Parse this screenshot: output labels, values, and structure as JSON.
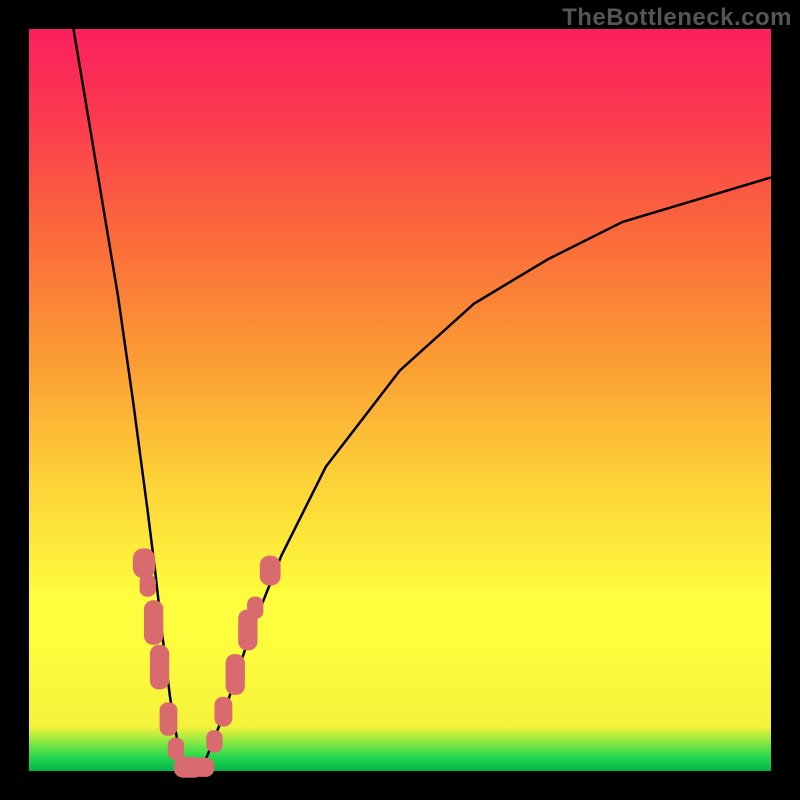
{
  "watermark": "TheBottleneck.com",
  "colors": {
    "page_bg": "#000000",
    "gradient_top": "#fb1f5e",
    "gradient_mid": "#fefe3e",
    "gradient_bottom": "#00b64a",
    "curve": "#000000",
    "marker": "#d96b6e"
  },
  "chart_data": {
    "type": "line",
    "title": "",
    "xlabel": "",
    "ylabel": "",
    "xlim": [
      0,
      100
    ],
    "ylim": [
      0,
      100
    ],
    "grid": false,
    "legend": false,
    "series": [
      {
        "name": "bottleneck-curve",
        "x": [
          6,
          8,
          10,
          12,
          14,
          16,
          17,
          18,
          19,
          20,
          21,
          22,
          23,
          24,
          26,
          28,
          30,
          34,
          40,
          50,
          60,
          70,
          80,
          90,
          100
        ],
        "y": [
          100,
          88,
          76,
          64,
          50,
          35,
          27,
          18,
          10,
          4,
          0,
          0,
          0,
          2,
          7,
          13,
          19,
          29,
          41,
          54,
          63,
          69,
          74,
          77,
          80
        ]
      }
    ],
    "markers": [
      {
        "x": 15.5,
        "y": 28,
        "shape": "rounded-rect",
        "w": 3.0,
        "h": 4.0
      },
      {
        "x": 16.0,
        "y": 25,
        "shape": "rounded-rect",
        "w": 2.2,
        "h": 3.0
      },
      {
        "x": 16.8,
        "y": 20,
        "shape": "rounded-rect",
        "w": 2.6,
        "h": 6.0
      },
      {
        "x": 17.6,
        "y": 14,
        "shape": "rounded-rect",
        "w": 2.6,
        "h": 6.0
      },
      {
        "x": 18.8,
        "y": 7,
        "shape": "rounded-rect",
        "w": 2.4,
        "h": 4.5
      },
      {
        "x": 19.8,
        "y": 3,
        "shape": "rounded-rect",
        "w": 2.2,
        "h": 3.0
      },
      {
        "x": 21.5,
        "y": 0.5,
        "shape": "rounded-rect",
        "w": 4.0,
        "h": 2.8
      },
      {
        "x": 23.5,
        "y": 0.5,
        "shape": "rounded-rect",
        "w": 3.0,
        "h": 2.6
      },
      {
        "x": 25.0,
        "y": 4,
        "shape": "rounded-rect",
        "w": 2.2,
        "h": 3.0
      },
      {
        "x": 26.2,
        "y": 8,
        "shape": "rounded-rect",
        "w": 2.4,
        "h": 4.0
      },
      {
        "x": 27.8,
        "y": 13,
        "shape": "rounded-rect",
        "w": 2.6,
        "h": 5.5
      },
      {
        "x": 29.5,
        "y": 19,
        "shape": "rounded-rect",
        "w": 2.6,
        "h": 5.5
      },
      {
        "x": 30.5,
        "y": 22,
        "shape": "rounded-rect",
        "w": 2.2,
        "h": 3.0
      },
      {
        "x": 32.5,
        "y": 27,
        "shape": "rounded-rect",
        "w": 2.8,
        "h": 4.0
      }
    ]
  }
}
